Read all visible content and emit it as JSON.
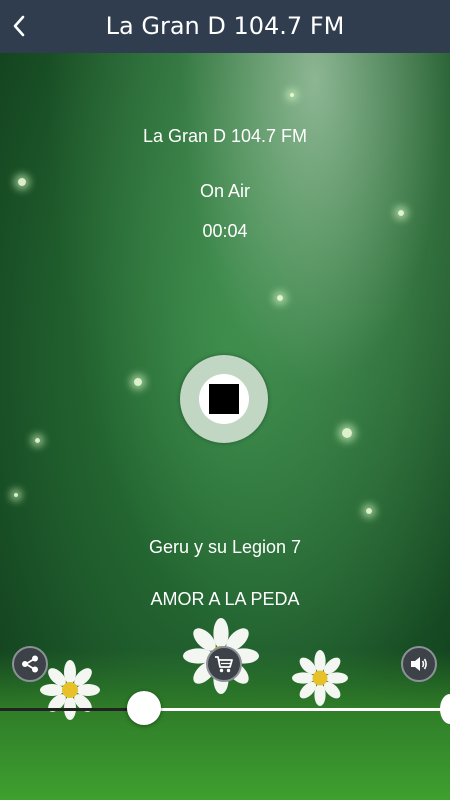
{
  "navbar": {
    "title": "La Gran D 104.7 FM"
  },
  "player": {
    "station_name": "La Gran D 104.7 FM",
    "status": "On Air",
    "elapsed": "00:04",
    "artist": "Geru y su Legion 7",
    "song": "AMOR A LA PEDA"
  },
  "volume": {
    "level_fraction": 0.32
  },
  "icons": {
    "back": "chevron-left-icon",
    "stop": "stop-icon",
    "share": "share-icon",
    "cart": "shopping-cart-icon",
    "volume": "speaker-volume-icon"
  },
  "colors": {
    "navbar": "#2f3d4f",
    "background": "#1f5c2c"
  }
}
